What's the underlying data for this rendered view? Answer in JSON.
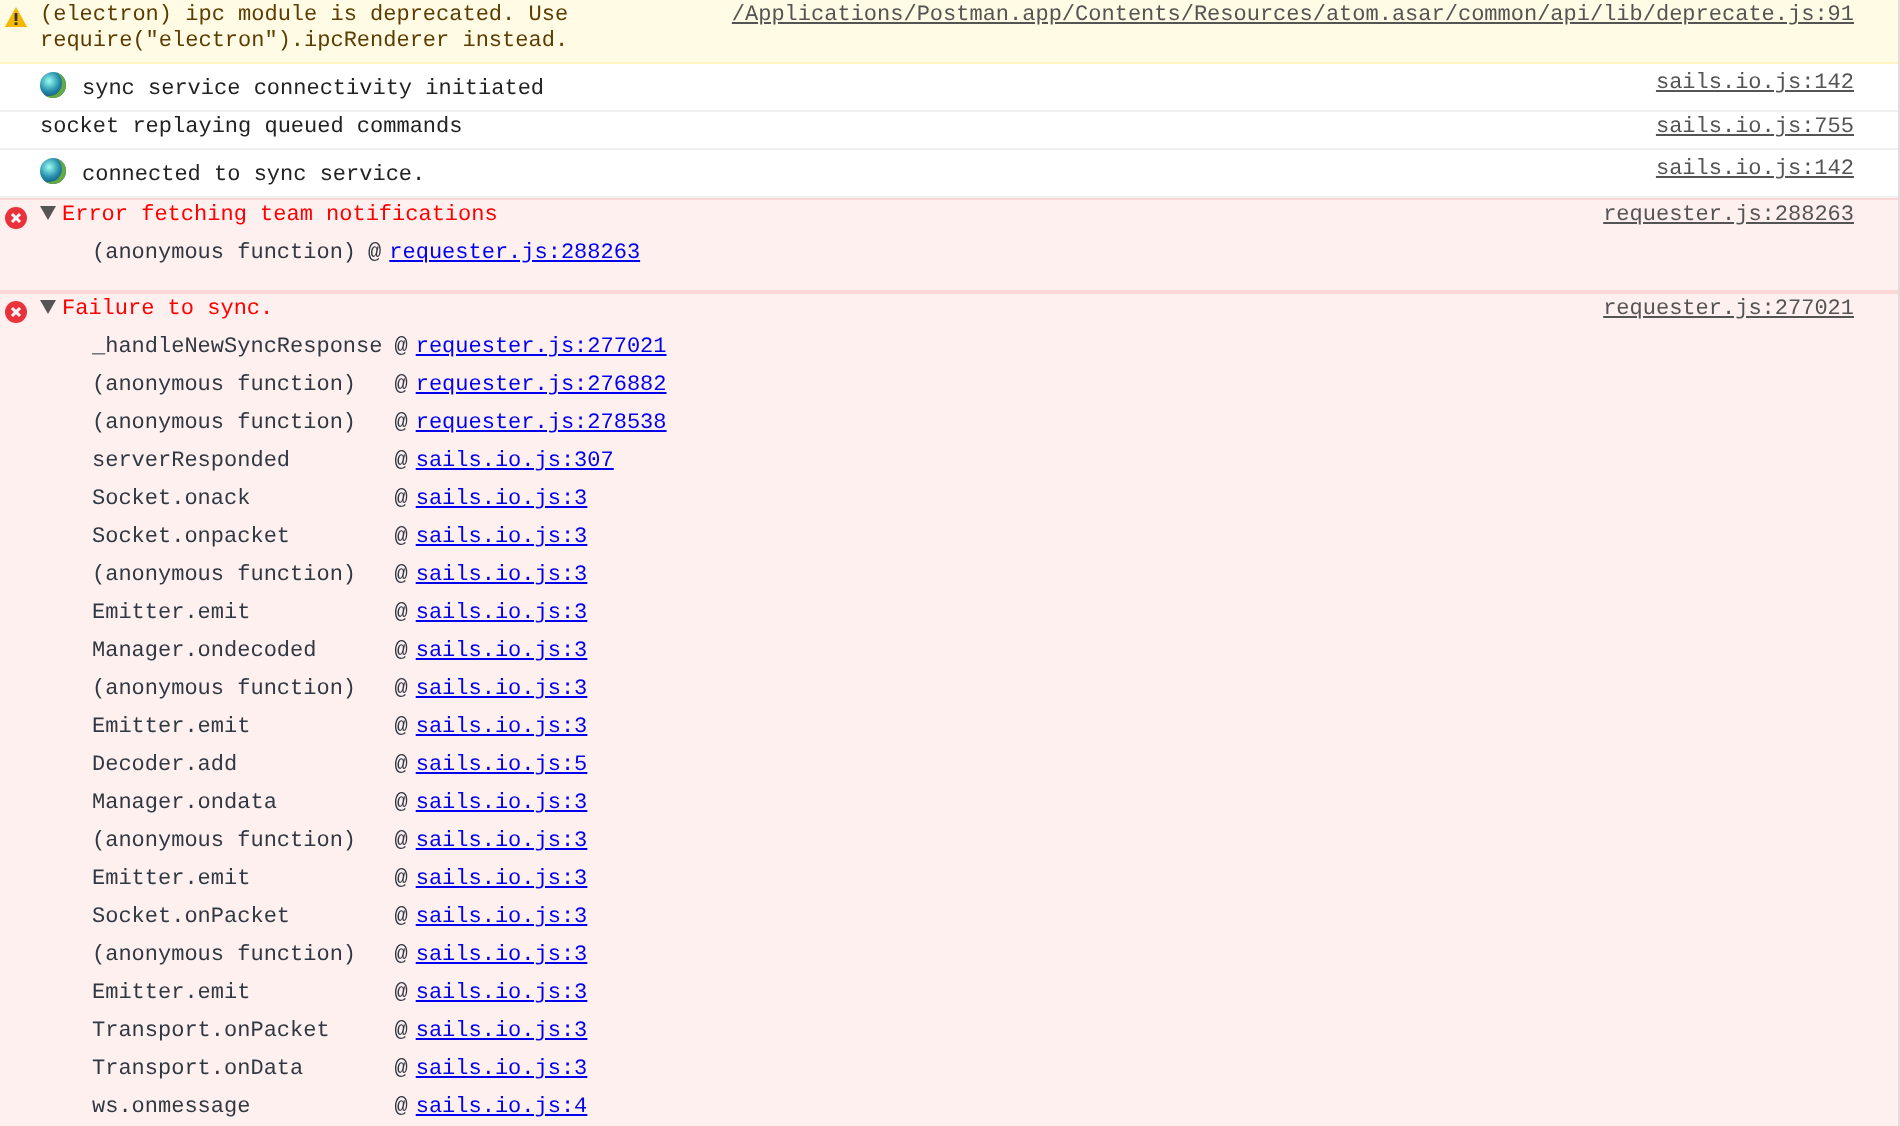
{
  "messages": [
    {
      "kind": "warning",
      "text": "(electron) ipc module is deprecated. Use\nrequire(\"electron\").ipcRenderer instead.",
      "source": "/Applications/Postman.app/Contents/Resources/atom.asar/common/api/lib/deprecate.js:91"
    },
    {
      "kind": "log",
      "globe": true,
      "text": "sync service connectivity initiated",
      "source": "sails.io.js:142"
    },
    {
      "kind": "log",
      "globe": false,
      "text": "socket replaying queued commands",
      "source": "sails.io.js:755"
    },
    {
      "kind": "log",
      "globe": true,
      "text": "connected to sync service.",
      "source": "sails.io.js:142"
    },
    {
      "kind": "error",
      "expanded": true,
      "text": "Error fetching team notifications",
      "source": "requester.js:288263",
      "stack": [
        {
          "function": "(anonymous function)",
          "at": "@",
          "link": "requester.js:288263"
        }
      ]
    },
    {
      "kind": "error",
      "expanded": true,
      "text": "Failure to sync.",
      "source": "requester.js:277021",
      "stack": [
        {
          "function": "_handleNewSyncResponse",
          "at": "@",
          "link": "requester.js:277021"
        },
        {
          "function": "(anonymous function)",
          "at": "@",
          "link": "requester.js:276882"
        },
        {
          "function": "(anonymous function)",
          "at": "@",
          "link": "requester.js:278538"
        },
        {
          "function": "serverResponded",
          "at": "@",
          "link": "sails.io.js:307"
        },
        {
          "function": "Socket.onack",
          "at": "@",
          "link": "sails.io.js:3"
        },
        {
          "function": "Socket.onpacket",
          "at": "@",
          "link": "sails.io.js:3"
        },
        {
          "function": "(anonymous function)",
          "at": "@",
          "link": "sails.io.js:3"
        },
        {
          "function": "Emitter.emit",
          "at": "@",
          "link": "sails.io.js:3"
        },
        {
          "function": "Manager.ondecoded",
          "at": "@",
          "link": "sails.io.js:3"
        },
        {
          "function": "(anonymous function)",
          "at": "@",
          "link": "sails.io.js:3"
        },
        {
          "function": "Emitter.emit",
          "at": "@",
          "link": "sails.io.js:3"
        },
        {
          "function": "Decoder.add",
          "at": "@",
          "link": "sails.io.js:5"
        },
        {
          "function": "Manager.ondata",
          "at": "@",
          "link": "sails.io.js:3"
        },
        {
          "function": "(anonymous function)",
          "at": "@",
          "link": "sails.io.js:3"
        },
        {
          "function": "Emitter.emit",
          "at": "@",
          "link": "sails.io.js:3"
        },
        {
          "function": "Socket.onPacket",
          "at": "@",
          "link": "sails.io.js:3"
        },
        {
          "function": "(anonymous function)",
          "at": "@",
          "link": "sails.io.js:3"
        },
        {
          "function": "Emitter.emit",
          "at": "@",
          "link": "sails.io.js:3"
        },
        {
          "function": "Transport.onPacket",
          "at": "@",
          "link": "sails.io.js:3"
        },
        {
          "function": "Transport.onData",
          "at": "@",
          "link": "sails.io.js:3"
        },
        {
          "function": "ws.onmessage",
          "at": "@",
          "link": "sails.io.js:4"
        }
      ]
    }
  ]
}
